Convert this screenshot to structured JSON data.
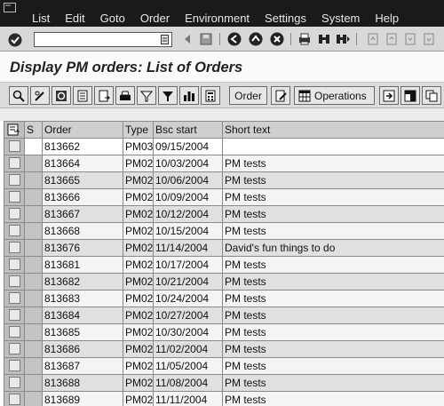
{
  "menu": {
    "items": [
      {
        "label": "List"
      },
      {
        "label": "Edit"
      },
      {
        "label": "Goto"
      },
      {
        "label": "Order"
      },
      {
        "label": "Environment"
      },
      {
        "label": "Settings"
      },
      {
        "label": "System"
      },
      {
        "label": "Help"
      }
    ]
  },
  "toolbar": {
    "command_value": ""
  },
  "page": {
    "title": "Display PM orders: List of Orders"
  },
  "app_toolbar": {
    "order_label": "Order",
    "operations_label": "Operations"
  },
  "table": {
    "columns": [
      "S",
      "Order",
      "Type",
      "Bsc start",
      "Short text"
    ],
    "rows": [
      {
        "order": "813662",
        "type": "PM03",
        "start": "09/15/2004",
        "text": ""
      },
      {
        "order": "813664",
        "type": "PM02",
        "start": "10/03/2004",
        "text": "PM tests"
      },
      {
        "order": "813665",
        "type": "PM02",
        "start": "10/06/2004",
        "text": "PM tests"
      },
      {
        "order": "813666",
        "type": "PM02",
        "start": "10/09/2004",
        "text": "PM tests"
      },
      {
        "order": "813667",
        "type": "PM02",
        "start": "10/12/2004",
        "text": "PM tests"
      },
      {
        "order": "813668",
        "type": "PM02",
        "start": "10/15/2004",
        "text": "PM tests"
      },
      {
        "order": "813676",
        "type": "PM02",
        "start": "11/14/2004",
        "text": "David's fun things to do"
      },
      {
        "order": "813681",
        "type": "PM02",
        "start": "10/17/2004",
        "text": "PM tests"
      },
      {
        "order": "813682",
        "type": "PM02",
        "start": "10/21/2004",
        "text": "PM tests"
      },
      {
        "order": "813683",
        "type": "PM02",
        "start": "10/24/2004",
        "text": "PM tests"
      },
      {
        "order": "813684",
        "type": "PM02",
        "start": "10/27/2004",
        "text": "PM tests"
      },
      {
        "order": "813685",
        "type": "PM02",
        "start": "10/30/2004",
        "text": "PM tests"
      },
      {
        "order": "813686",
        "type": "PM02",
        "start": "11/02/2004",
        "text": "PM tests"
      },
      {
        "order": "813687",
        "type": "PM02",
        "start": "11/05/2004",
        "text": "PM tests"
      },
      {
        "order": "813688",
        "type": "PM02",
        "start": "11/08/2004",
        "text": "PM tests"
      },
      {
        "order": "813689",
        "type": "PM02",
        "start": "11/11/2004",
        "text": "PM tests"
      }
    ]
  }
}
